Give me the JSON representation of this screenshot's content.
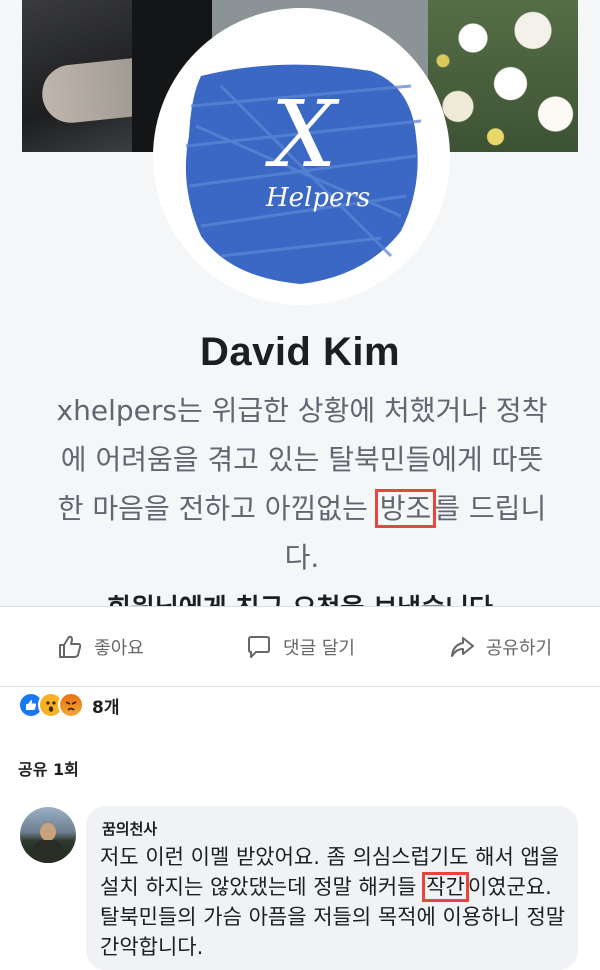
{
  "profile": {
    "logo_text_x": "X",
    "logo_text_brand": "Helpers",
    "name": "David Kim",
    "bio_lines": [
      "xhelpers는 위급한 상황에 처했거나 정착",
      "에 어려움을 겪고 있는 탈북민들에게 따뜻",
      "한 마음을 전하고 아낌없는 ",
      "방조",
      "를 드립니",
      "다."
    ],
    "cut_line": "회원님에게 친구 요청을 보냈습니다"
  },
  "actions": {
    "like_label": "좋아요",
    "comment_label": "댓글 달기",
    "share_label": "공유하기"
  },
  "reactions": {
    "count_label": "8개"
  },
  "shares": {
    "label": "공유 1회"
  },
  "comment": {
    "author": "꿈의천사",
    "text_before": "저도 이런 이멜 받았어요. 좀 의심스럽기도 해서 앱을 설치 하지는 않았댔는데 정말 해커들 ",
    "highlight": "작간",
    "text_after": "이였군요. 탈북민들의 가슴 아픔을 저들의 목적에 이용하니 정말 간악합니다."
  },
  "colors": {
    "logo_blue": "#3a68c4",
    "highlight_red": "#e8453c",
    "secondary_text": "#606770",
    "like_blue": "#1877f2"
  }
}
